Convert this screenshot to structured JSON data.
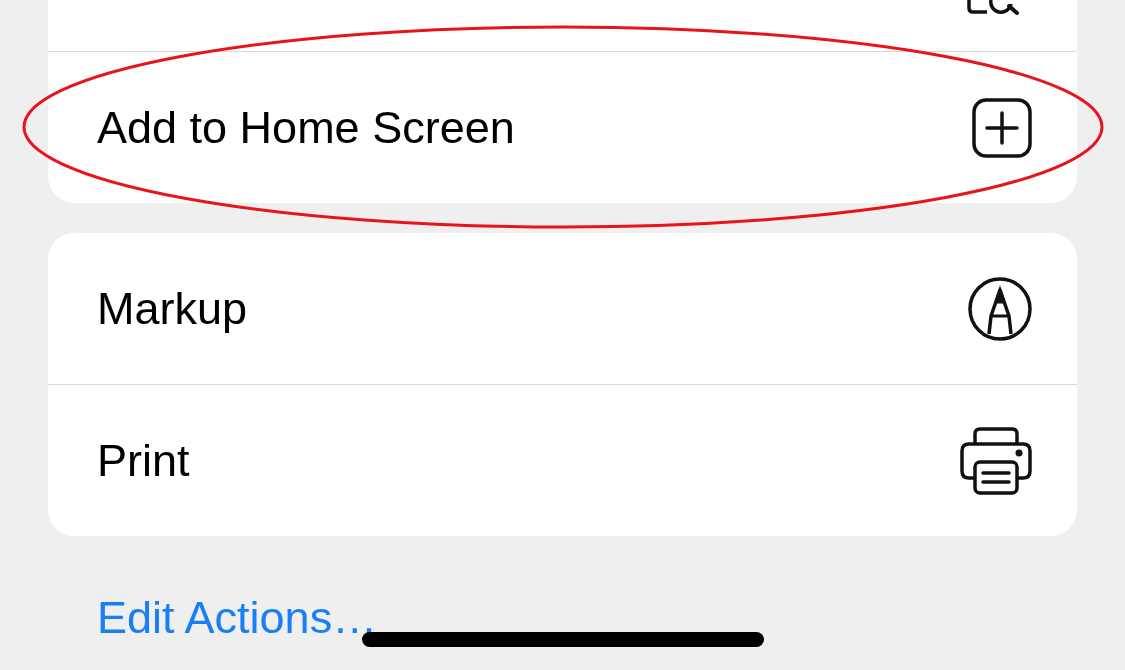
{
  "groups": [
    {
      "rows": [
        {
          "kind": "find"
        },
        {
          "kind": "add",
          "label": "Add to Home Screen"
        }
      ]
    },
    {
      "rows": [
        {
          "kind": "markup",
          "label": "Markup"
        },
        {
          "kind": "print",
          "label": "Print"
        }
      ]
    }
  ],
  "edit_link": "Edit Actions…",
  "annotation": {
    "kind": "ellipse",
    "color": "#e8141c"
  }
}
